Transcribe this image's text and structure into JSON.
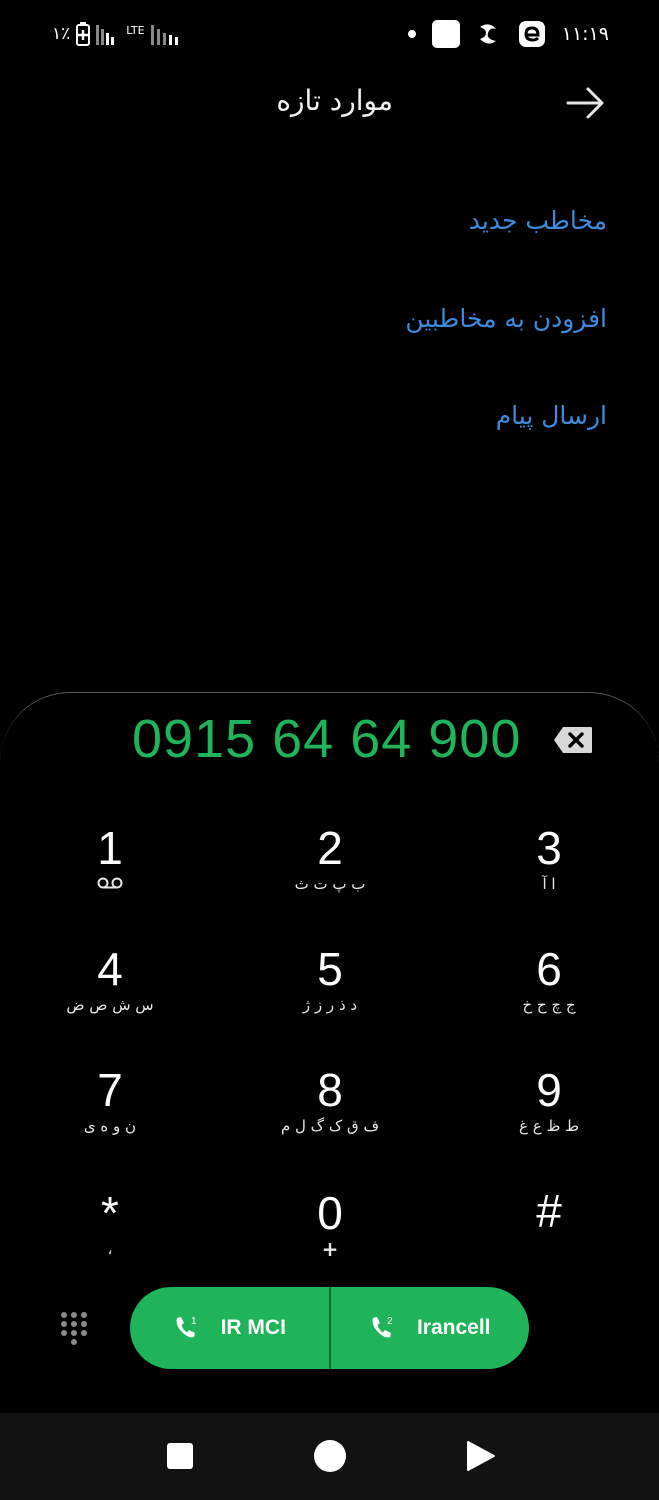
{
  "status_bar": {
    "battery_percent": "۱٪",
    "network_type": "LTE",
    "time": "۱۱:۱۹"
  },
  "header": {
    "title": "موارد تازه",
    "back_icon": "arrow-right-icon"
  },
  "actions": [
    {
      "label": "مخاطب جدید"
    },
    {
      "label": "افزودن به مخاطبین"
    },
    {
      "label": "ارسال پیام"
    }
  ],
  "dialer": {
    "number": "0915 64 64 900",
    "backspace_icon": "backspace-icon",
    "keys": [
      {
        "digit": "1",
        "sub": "ᦶ"
      },
      {
        "digit": "2",
        "sub": "ب پ ت ث"
      },
      {
        "digit": "3",
        "sub": "ا آ"
      },
      {
        "digit": "4",
        "sub": "س ش ص ض"
      },
      {
        "digit": "5",
        "sub": "د ذ ر ز ژ"
      },
      {
        "digit": "6",
        "sub": "ج چ ح خ"
      },
      {
        "digit": "7",
        "sub": "ن و ه ی"
      },
      {
        "digit": "8",
        "sub": "ف ق ک گ ل م"
      },
      {
        "digit": "9",
        "sub": "ط ظ ع غ"
      },
      {
        "digit": "*",
        "sub": "،"
      },
      {
        "digit": "0",
        "sub": "+"
      },
      {
        "digit": "#",
        "sub": ""
      }
    ]
  },
  "call_buttons": [
    {
      "sim": "1",
      "label": "IR MCI"
    },
    {
      "sim": "2",
      "label": "Irancell"
    }
  ],
  "colors": {
    "accent_green": "#1fb35a",
    "link_blue": "#3d8bdc",
    "background": "#000000"
  }
}
